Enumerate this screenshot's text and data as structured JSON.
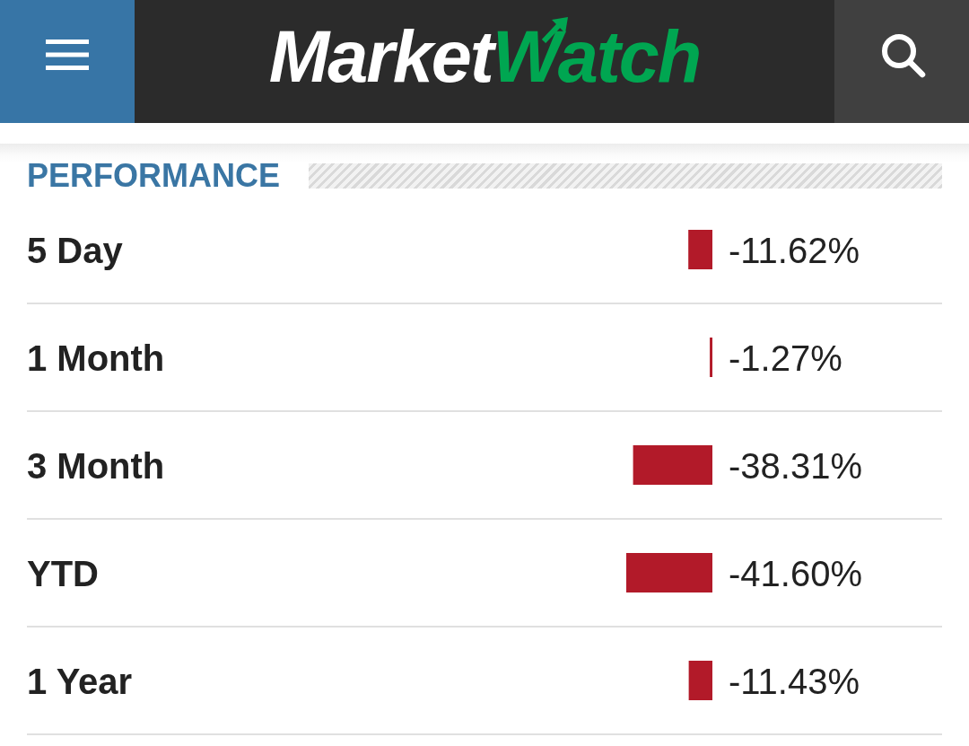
{
  "header": {
    "logo": {
      "first": "Market",
      "second": "Watch"
    }
  },
  "performance": {
    "title": "PERFORMANCE",
    "chart_data": {
      "type": "bar",
      "orientation": "horizontal",
      "categories": [
        "5 Day",
        "1 Month",
        "3 Month",
        "YTD",
        "1 Year"
      ],
      "values": [
        -11.62,
        -1.27,
        -38.31,
        -41.6,
        -11.43
      ],
      "value_labels": [
        "-11.62%",
        "-1.27%",
        "-38.31%",
        "-41.60%",
        "-11.43%"
      ]
    }
  }
}
